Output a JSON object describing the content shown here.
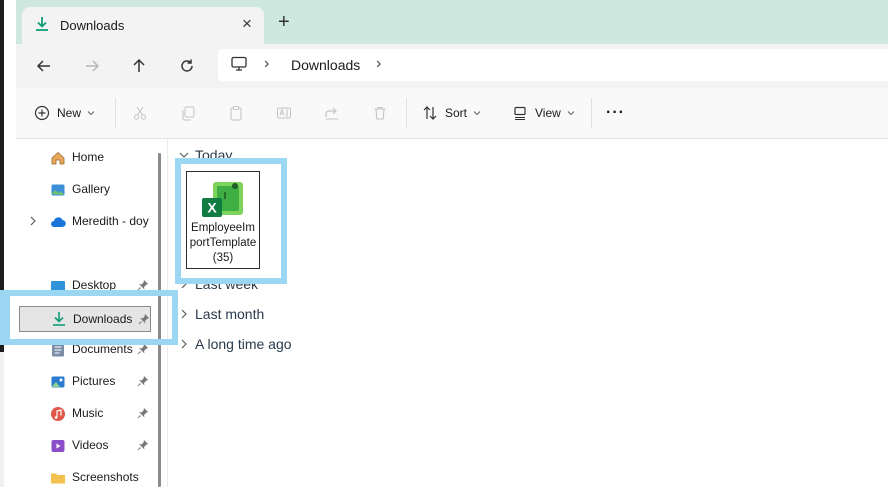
{
  "tab": {
    "title": "Downloads",
    "close": "×",
    "new_tab": "+"
  },
  "address": {
    "crumbs": [
      "Downloads"
    ],
    "sep": "›"
  },
  "toolbar": {
    "new_label": "New",
    "sort_label": "Sort",
    "view_label": "View",
    "more": "···"
  },
  "sidebar": {
    "items": [
      {
        "label": "Home",
        "icon": "home-icon"
      },
      {
        "label": "Gallery",
        "icon": "gallery-icon"
      },
      {
        "label": "Meredith - doy",
        "icon": "onedrive-cloud-icon"
      },
      {
        "label": "Desktop",
        "icon": "desktop-icon",
        "pinned": true
      },
      {
        "label": "Downloads",
        "icon": "download-icon",
        "pinned": true,
        "selected": true
      },
      {
        "label": "Documents",
        "icon": "documents-icon",
        "pinned": true
      },
      {
        "label": "Pictures",
        "icon": "pictures-icon",
        "pinned": true
      },
      {
        "label": "Music",
        "icon": "music-icon",
        "pinned": true
      },
      {
        "label": "Videos",
        "icon": "videos-icon",
        "pinned": true
      },
      {
        "label": "Screenshots",
        "icon": "folder-icon"
      }
    ]
  },
  "content": {
    "groups": [
      {
        "label": "Today",
        "expanded": true
      },
      {
        "label": "Last week",
        "expanded": false
      },
      {
        "label": "Last month",
        "expanded": false
      },
      {
        "label": "A long time ago",
        "expanded": false
      }
    ],
    "file": {
      "name": "EmployeeImportTemplate (35)",
      "icon": "excel-file-icon"
    }
  },
  "colors": {
    "tabbar": "#cfe8df",
    "accent": "#0f9d76",
    "highlight": "#9bd6f2",
    "excel": "#107c41"
  }
}
